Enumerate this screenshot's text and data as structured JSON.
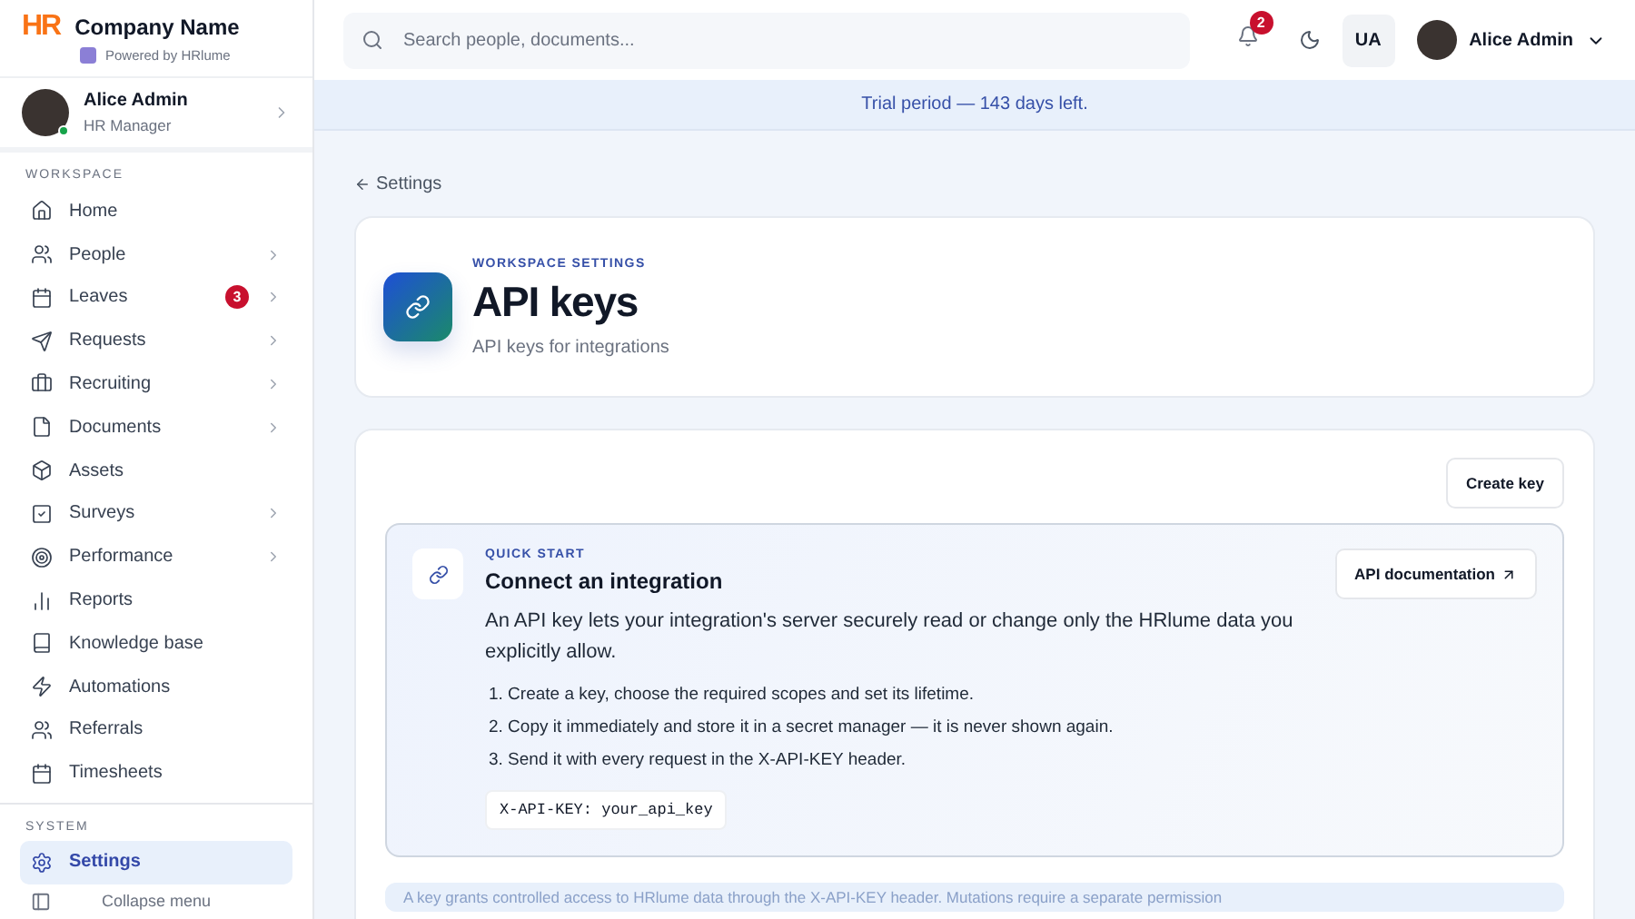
{
  "brand": {
    "logo": "HR",
    "name": "Company Name",
    "powered_by": "Powered by HRlume"
  },
  "user_card": {
    "name": "Alice Admin",
    "role": "HR Manager",
    "online": true
  },
  "sidebar": {
    "sections": [
      {
        "title": "WORKSPACE",
        "items": [
          {
            "label": "Home",
            "selected": false,
            "has_submenu": false
          },
          {
            "label": "People",
            "selected": false,
            "has_submenu": true
          },
          {
            "label": "Leaves",
            "selected": false,
            "has_submenu": true,
            "badge": "3"
          },
          {
            "label": "Requests",
            "selected": false,
            "has_submenu": true
          },
          {
            "label": "Recruiting",
            "selected": false,
            "has_submenu": true
          },
          {
            "label": "Documents",
            "selected": false,
            "has_submenu": true
          },
          {
            "label": "Assets",
            "selected": false,
            "has_submenu": false
          },
          {
            "label": "Surveys",
            "selected": false,
            "has_submenu": true
          },
          {
            "label": "Performance",
            "selected": false,
            "has_submenu": true
          },
          {
            "label": "Reports",
            "selected": false,
            "has_submenu": false
          },
          {
            "label": "Knowledge base",
            "selected": false,
            "has_submenu": false
          },
          {
            "label": "Automations",
            "selected": false,
            "has_submenu": false
          },
          {
            "label": "Referrals",
            "selected": false,
            "has_submenu": false
          },
          {
            "label": "Timesheets",
            "selected": false,
            "has_submenu": false
          }
        ]
      },
      {
        "title": "SYSTEM",
        "items": [
          {
            "label": "Settings",
            "selected": true,
            "has_submenu": false
          }
        ]
      }
    ],
    "collapse_menu": "Collapse menu"
  },
  "topbar": {
    "search": {
      "placeholder": "Search people, documents..."
    },
    "notifications": "2",
    "language": "UA",
    "user_name": "Alice Admin"
  },
  "banner": "Trial period — 143 days left.",
  "back_link": "Settings",
  "page_header": {
    "eyebrow": "WORKSPACE SETTINGS",
    "title": "API keys",
    "subtitle": "API keys for integrations"
  },
  "create_button": "Create key",
  "quick_start": {
    "eyebrow": "QUICK START",
    "title": "Connect an integration",
    "description": "An API key lets your integration's server securely read or change only the HRlume data you explicitly allow.",
    "steps": [
      "1. Create a key, choose the required scopes and set its lifetime.",
      "2. Copy it immediately and store it in a secret manager — it is never shown again.",
      "3. Send it with every request in the X-API-KEY header."
    ],
    "code": "X-API-KEY: your_api_key",
    "doc_button": "API documentation"
  },
  "notice": "A key grants controlled access to HRlume data through the X-API-KEY header. Mutations require a separate permission"
}
